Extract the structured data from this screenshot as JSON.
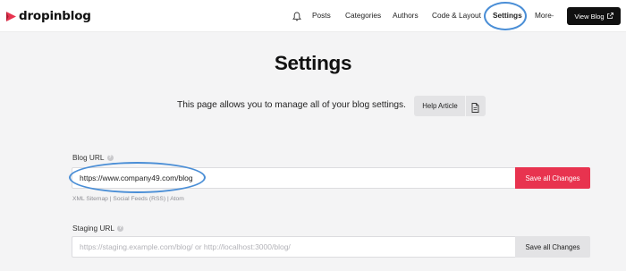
{
  "nav": {
    "brand": "dropinblog",
    "items": [
      {
        "label": "Posts"
      },
      {
        "label": "Categories"
      },
      {
        "label": "Authors"
      },
      {
        "label": "Code & Layout"
      },
      {
        "label": "Settings"
      },
      {
        "label": "More"
      }
    ],
    "view_blog_label": "View Blog"
  },
  "page": {
    "title": "Settings",
    "intro": "This page allows you to manage all of your blog settings.",
    "help_label": "Help Article"
  },
  "blog_url": {
    "label": "Blog URL",
    "value": "https://www.company49.com/blog",
    "button_label": "Save all Changes",
    "links": [
      "XML Sitemap",
      "Social Feeds (RSS)",
      "Atom"
    ]
  },
  "staging_url": {
    "label": "Staging URL",
    "placeholder": "https://staging.example.com/blog/ or http://localhost:3000/blog/",
    "button_label": "Save all Changes"
  },
  "colors": {
    "accent": "#e8334f",
    "highlight": "#4a8ed6",
    "nav_button": "#111111"
  }
}
